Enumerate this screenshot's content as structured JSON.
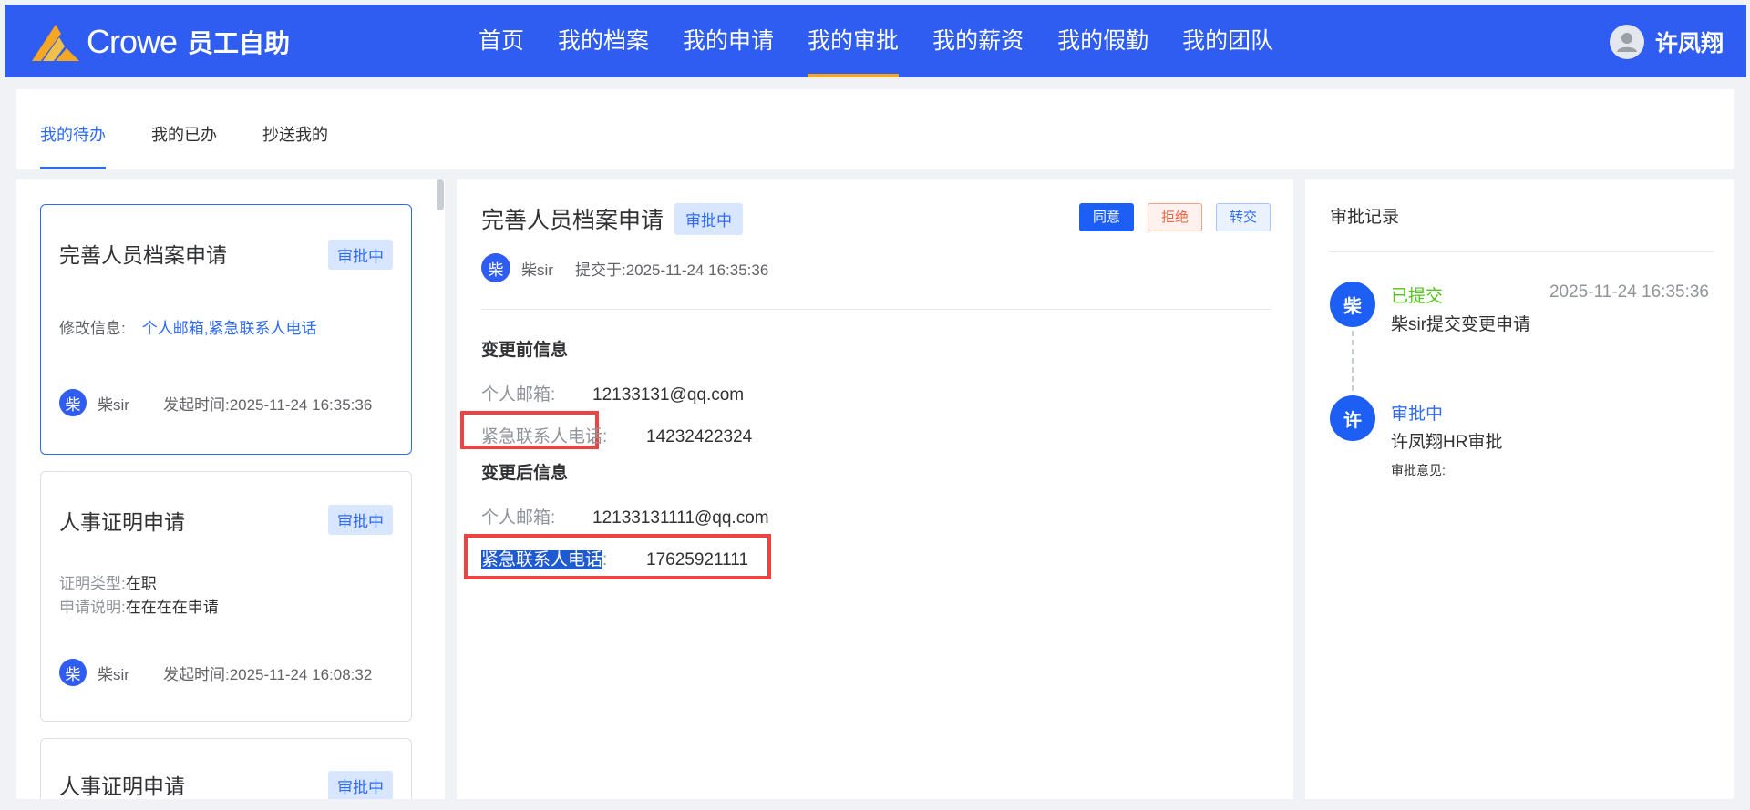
{
  "brand": {
    "name": "Crowe",
    "subtitle": "员工自助"
  },
  "nav": {
    "items": [
      {
        "label": "首页"
      },
      {
        "label": "我的档案"
      },
      {
        "label": "我的申请"
      },
      {
        "label": "我的审批",
        "active": true
      },
      {
        "label": "我的薪资"
      },
      {
        "label": "我的假勤"
      },
      {
        "label": "我的团队"
      }
    ],
    "user_name": "许凤翔"
  },
  "tabs": [
    "我的待办",
    "我的已办",
    "抄送我的"
  ],
  "list": {
    "cards": [
      {
        "title": "完善人员档案申请",
        "status": "审批中",
        "field_label": "修改信息:",
        "field_value": "个人邮箱,紧急联系人电话",
        "avatar": "柴",
        "user": "柴sir",
        "time_label": "发起时间:",
        "time": "2025-11-24 16:35:36"
      },
      {
        "title": "人事证明申请",
        "status": "审批中",
        "field1_label": "证明类型:",
        "field1_value": "在职",
        "field2_label": "申请说明:",
        "field2_value": "在在在在申请",
        "avatar": "柴",
        "user": "柴sir",
        "time_label": "发起时间:",
        "time": "2025-11-24 16:08:32"
      },
      {
        "title": "人事证明申请",
        "status": "审批中"
      }
    ]
  },
  "detail": {
    "title": "完善人员档案申请",
    "status": "审批中",
    "actions": {
      "agree": "同意",
      "reject": "拒绝",
      "transfer": "转交"
    },
    "avatar": "柴",
    "user": "柴sir",
    "submitted_label": "提交于:",
    "submitted_time": "2025-11-24 16:35:36",
    "before": {
      "title": "变更前信息",
      "email_label": "个人邮箱:",
      "email": "12133131@qq.com",
      "phone_label": "紧急联系人电话:",
      "phone": "14232422324"
    },
    "after": {
      "title": "变更后信息",
      "email_label": "个人邮箱:",
      "email": "12133131111@qq.com",
      "phone_label_selected": "紧急联系人电话",
      "phone_label_colon": ":",
      "phone": "17625921111"
    }
  },
  "record": {
    "title": "审批记录",
    "items": [
      {
        "avatar": "柴",
        "status": "已提交",
        "time": "2025-11-24 16:35:36",
        "desc": "柴sir提交变更申请"
      },
      {
        "avatar": "许",
        "status": "审批中",
        "desc": "许凤翔HR审批",
        "note": "审批意见:"
      }
    ]
  },
  "colors": {
    "header_bg": "#2f5cf1",
    "accent": "#2f6bf5",
    "nav_active_underline": "#f5a623",
    "reject": "#f2643d",
    "success": "#52c41a",
    "highlight_box": "#ee4343"
  }
}
